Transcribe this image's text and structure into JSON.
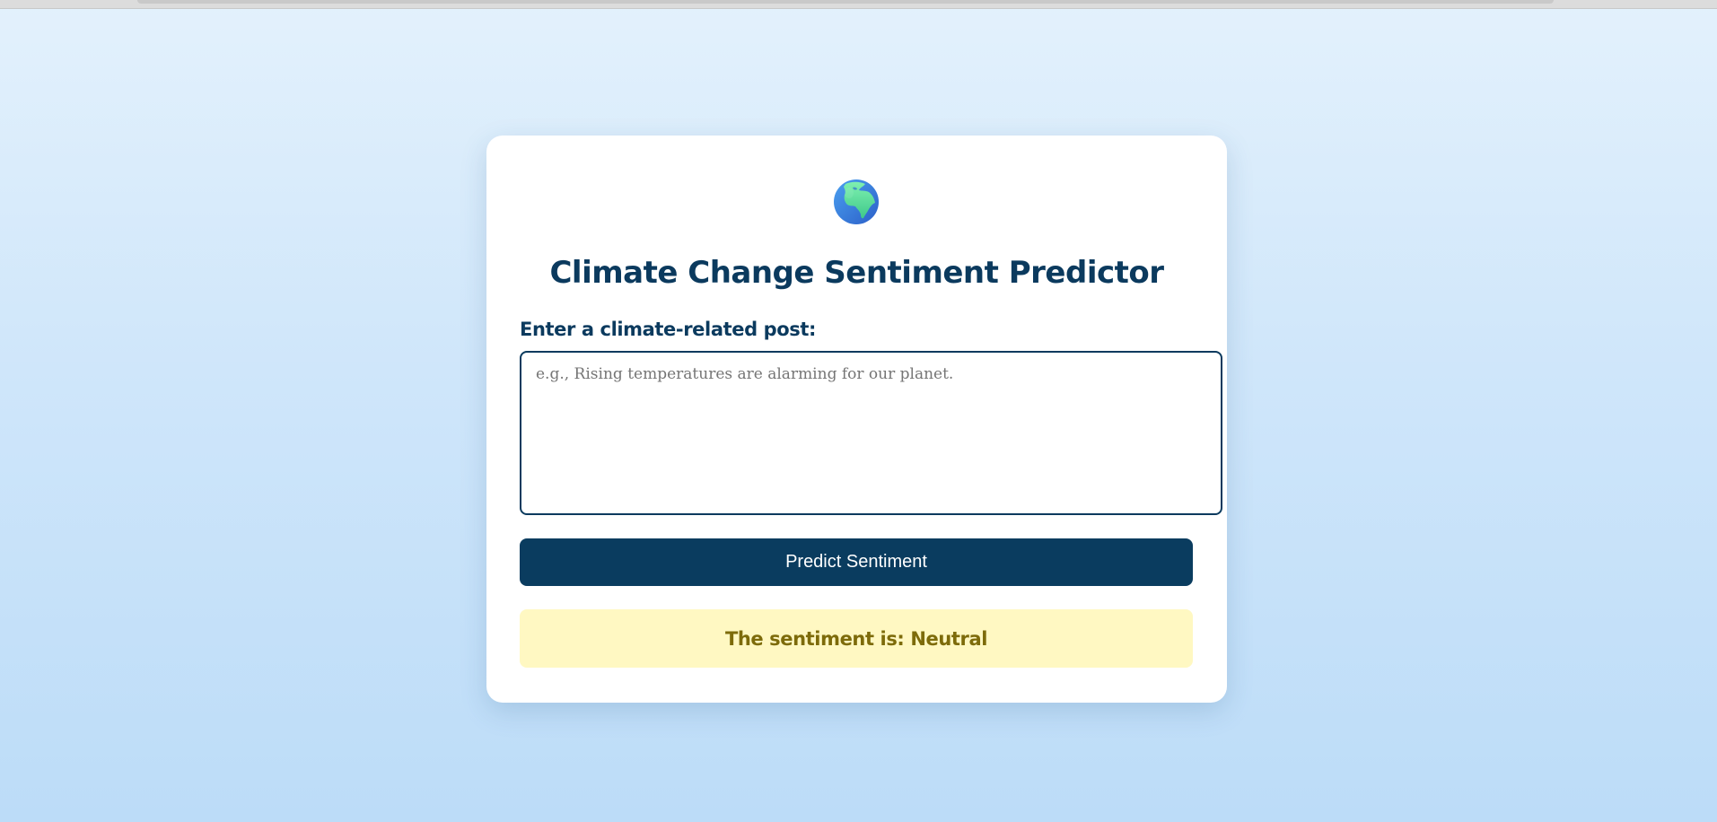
{
  "app": {
    "title": "Climate Change Sentiment Predictor",
    "logo_icon": "globe-europe-africa-icon"
  },
  "form": {
    "label": "Enter a climate-related post:",
    "placeholder": "e.g., Rising temperatures are alarming for our planet.",
    "value": "",
    "submit_label": "Predict Sentiment"
  },
  "result": {
    "text": "The sentiment is: Neutral",
    "sentiment": "Neutral"
  },
  "colors": {
    "primary": "#0a3c5f",
    "title": "#0b3a5e",
    "result_bg": "#fff8c2",
    "result_text": "#7d6b0a",
    "page_bg_top": "#e3f1fc",
    "page_bg_bottom": "#bcdcf8"
  }
}
